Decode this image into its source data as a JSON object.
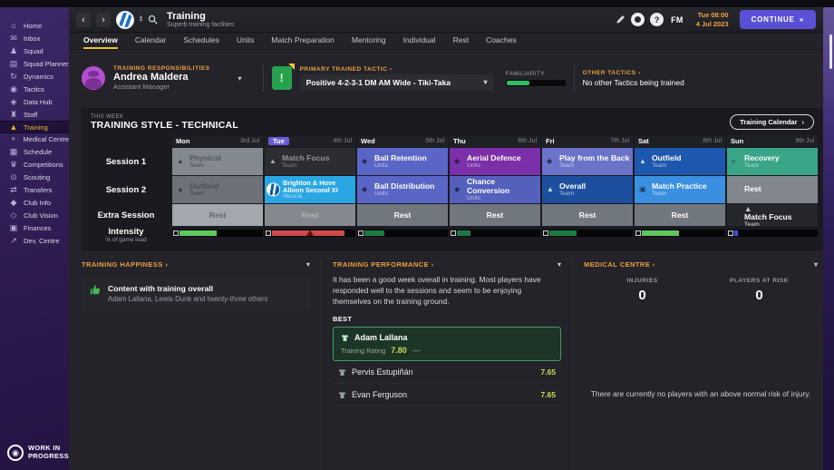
{
  "sidebar": {
    "items": [
      {
        "label": "Home",
        "icon": "home-icon"
      },
      {
        "label": "Inbox",
        "icon": "inbox-icon"
      },
      {
        "label": "Squad",
        "icon": "squad-icon"
      },
      {
        "label": "Squad Planner",
        "icon": "squad-planner-icon"
      },
      {
        "label": "Dynamics",
        "icon": "dynamics-icon"
      },
      {
        "label": "Tactics",
        "icon": "tactics-icon"
      },
      {
        "label": "Data Hub",
        "icon": "data-hub-icon"
      },
      {
        "label": "Staff",
        "icon": "staff-icon"
      },
      {
        "label": "Training",
        "icon": "training-icon",
        "active": true
      },
      {
        "label": "Medical Centre",
        "icon": "medical-icon"
      },
      {
        "label": "Schedule",
        "icon": "schedule-icon"
      },
      {
        "label": "Competitions",
        "icon": "competitions-icon"
      },
      {
        "label": "Scouting",
        "icon": "scouting-icon"
      },
      {
        "label": "Transfers",
        "icon": "transfers-icon"
      },
      {
        "label": "Club Info",
        "icon": "club-info-icon"
      },
      {
        "label": "Club Vision",
        "icon": "club-vision-icon"
      },
      {
        "label": "Finances",
        "icon": "finances-icon"
      },
      {
        "label": "Dev. Centre",
        "icon": "dev-centre-icon"
      }
    ],
    "wip": "WORK IN PROGRESS"
  },
  "header": {
    "title": "Training",
    "subtitle": "Superb training facilities",
    "fm_logo": "FM",
    "help": "?",
    "date_line1": "Tue 08:00",
    "date_line2": "4 Jul 2023",
    "continue_label": "CONTINUE",
    "continue_arrow": "»",
    "back_arrow": "‹",
    "forward_arrow": "›"
  },
  "tabs": [
    {
      "label": "Overview",
      "active": true
    },
    {
      "label": "Calendar"
    },
    {
      "label": "Schedules"
    },
    {
      "label": "Units"
    },
    {
      "label": "Match Preparation"
    },
    {
      "label": "Mentoring"
    },
    {
      "label": "Individual"
    },
    {
      "label": "Rest"
    },
    {
      "label": "Coaches"
    }
  ],
  "responsibilities": {
    "heading": "TRAINING RESPONSIBILITIES",
    "name": "Andrea Maldera",
    "role": "Assistant Manager"
  },
  "tactic": {
    "heading": "PRIMARY TRAINED TACTIC ›",
    "selected": "Positive 4-2-3-1 DM AM Wide - Tiki-Taka",
    "familiarity_label": "FAMILIARITY",
    "familiarity_pct": 38,
    "familiarity_color": "#2fbf63",
    "other_heading": "OTHER TACTICS ›",
    "other_text": "No other Tactics being trained"
  },
  "week": {
    "small_label": "THIS WEEK",
    "title": "TRAINING STYLE - TECHNICAL",
    "calendar_button": "Training Calendar",
    "row_labels": [
      "Session 1",
      "Session 2",
      "Extra Session"
    ],
    "intensity_label": "Intensity",
    "intensity_sub": "% of game load",
    "days": [
      {
        "name": "Mon",
        "date": "3rd Jul"
      },
      {
        "name": "Tue",
        "date": "4th Jul",
        "current": true
      },
      {
        "name": "Wed",
        "date": "5th Jul"
      },
      {
        "name": "Thu",
        "date": "6th Jul"
      },
      {
        "name": "Fri",
        "date": "7th Jul"
      },
      {
        "name": "Sat",
        "date": "8th Jul"
      },
      {
        "name": "Sun",
        "date": "9th Jul"
      }
    ],
    "session1": [
      {
        "title": "Physical",
        "sub": "Team",
        "icon": "cone-icon",
        "bg": "#84888f",
        "fg": "#54585e",
        "subfg": "rgba(40,44,50,.7)",
        "iconfg": "rgba(30,34,40,.7)"
      },
      {
        "title": "Match Focus",
        "sub": "Team",
        "icon": "cone-icon",
        "bg": "#2b2d31",
        "fg": "#8f939a",
        "subfg": "rgba(200,203,210,.5)",
        "iconfg": "rgba(220,222,228,.7)"
      },
      {
        "title": "Ball Retention",
        "sub": "Units",
        "icon": "whistle-icon",
        "bg": "#5a66c6",
        "iconfg": "rgba(15,20,40,.7)"
      },
      {
        "title": "Aerial Defence",
        "sub": "Units",
        "icon": "whistle-icon",
        "bg": "#7b2fa8",
        "iconfg": "rgba(15,20,40,.7)"
      },
      {
        "title": "Play from the Back",
        "sub": "Team",
        "icon": "whistle-icon",
        "bg": "#6a73c8",
        "iconfg": "rgba(15,20,40,.7)"
      },
      {
        "title": "Outfield",
        "sub": "Team",
        "icon": "cone-icon",
        "bg": "#1e57ae",
        "iconfg": "rgba(240,242,248,.85)"
      },
      {
        "title": "Recovery",
        "sub": "Team",
        "icon": "recovery-icon",
        "bg": "#3aa489",
        "iconfg": "rgba(15,40,30,.75)"
      }
    ],
    "session2": [
      {
        "title": "Outfield",
        "sub": "Team",
        "icon": "cone-icon",
        "bg": "#6d7178",
        "fg": "#4e5258",
        "subfg": "rgba(35,38,44,.7)",
        "iconfg": "rgba(30,34,40,.7)"
      },
      {
        "title": "Brighton & Hove Albion Second XI",
        "sub": "Neutral",
        "icon": "badge-brighton-icon",
        "bg": "#2aa6e4",
        "small": true
      },
      {
        "title": "Ball Distribution",
        "sub": "Units",
        "icon": "whistle-icon",
        "bg": "#5a66c6",
        "iconfg": "rgba(15,20,40,.7)"
      },
      {
        "title": "Chance Conversion",
        "sub": "Units",
        "icon": "whistle-icon",
        "bg": "#5560bd",
        "iconfg": "rgba(15,20,40,.7)"
      },
      {
        "title": "Overall",
        "sub": "Team",
        "icon": "cone-icon",
        "bg": "#1d4f9e",
        "iconfg": "rgba(240,242,248,.85)"
      },
      {
        "title": "Match Practice",
        "sub": "Team",
        "icon": "pitch-icon",
        "bg": "#3a8fe0",
        "iconfg": "rgba(15,25,50,.7)"
      },
      {
        "title": "Rest",
        "sub": "",
        "icon": "",
        "bg": "#82878e"
      }
    ],
    "extra": [
      {
        "title": "Rest",
        "bg": "#a3a8ae",
        "fg": "#5f646b"
      },
      {
        "title": "Rest",
        "bg": "#85898f",
        "fg": "#aeb1b6"
      },
      {
        "title": "Rest",
        "bg": "#71777f"
      },
      {
        "title": "Rest",
        "bg": "#71777f"
      },
      {
        "title": "Rest",
        "bg": "#71777f"
      },
      {
        "title": "Rest",
        "bg": "#71777f"
      },
      {
        "title": "Match Focus",
        "sub": "Team",
        "icon": "cone-icon",
        "bg": "#26272b",
        "iconfg": "rgba(230,232,238,.85)"
      }
    ],
    "intensity": [
      {
        "pct": 45,
        "color": "#5fc85f",
        "warn": false
      },
      {
        "pct": 88,
        "color": "#cf4b49",
        "warn": true
      },
      {
        "pct": 24,
        "color": "#1f7a42",
        "warn": false
      },
      {
        "pct": 17,
        "color": "#1f7a42",
        "warn": false
      },
      {
        "pct": 33,
        "color": "#1f7a42",
        "warn": false
      },
      {
        "pct": 45,
        "color": "#5fc85f",
        "warn": false
      },
      {
        "pct": 4,
        "color": "#4053d6",
        "warn": false
      }
    ]
  },
  "happiness": {
    "heading": "TRAINING HAPPINESS ›",
    "item_title": "Content with training overall",
    "item_sub": "Adam Lallana, Lewis Dunk and twenty-three others"
  },
  "performance": {
    "heading": "TRAINING PERFORMANCE ›",
    "summary": "It has been a good week overall in training. Most players have responded well to the sessions and seem to be enjoying themselves on the training ground.",
    "best_label": "BEST",
    "best": {
      "name": "Adam Lallana",
      "rating_label": "Training Rating",
      "rating": "7.80",
      "trend": "—"
    },
    "others": [
      {
        "name": "Pervis Estupiñán",
        "rating": "7.65"
      },
      {
        "name": "Evan Ferguson",
        "rating": "7.65"
      }
    ]
  },
  "medical": {
    "heading": "MEDICAL CENTRE ›",
    "injuries_label": "INJURIES",
    "injuries": "0",
    "risk_label": "PLAYERS AT RISK",
    "risk": "0",
    "note": "There are currently no players with an above normal risk of injury."
  }
}
